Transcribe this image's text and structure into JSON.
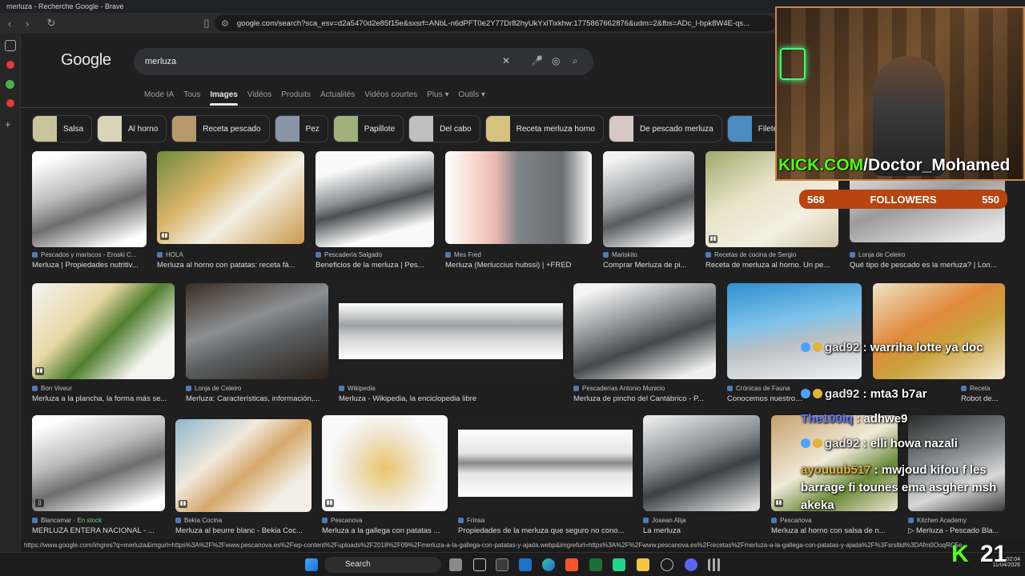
{
  "window": {
    "title": "merluza - Recherche Google - Brave"
  },
  "browser": {
    "url": "google.com/search?sca_esv=d2a5470d2e85f15e&sxsrf=ANbL-n6dPFT0e2Y77Dr82hyUkYxlTixkhw:1775867662876&udm=2&fbs=ADc_l-bpk8W4E-qs..."
  },
  "google": {
    "logo": "Google",
    "query": "merluza",
    "tabs": [
      {
        "label": "Mode IA"
      },
      {
        "label": "Tous"
      },
      {
        "label": "Images"
      },
      {
        "label": "Vidéos"
      },
      {
        "label": "Produits"
      },
      {
        "label": "Actualités"
      },
      {
        "label": "Vidéos courtes"
      },
      {
        "label": "Plus ▾"
      },
      {
        "label": "Outils ▾"
      }
    ],
    "chips": [
      {
        "label": "Salsa"
      },
      {
        "label": "Al horno"
      },
      {
        "label": "Receta pescado"
      },
      {
        "label": "Pez"
      },
      {
        "label": "Papillote"
      },
      {
        "label": "Del cabo"
      },
      {
        "label": "Receta merluza horno"
      },
      {
        "label": "De pescado merluza"
      },
      {
        "label": "Filete m"
      }
    ],
    "results": [
      {
        "source": "Pescados y mariscos - Eroski C...",
        "title": "Merluza | Propiedades nutritiv..."
      },
      {
        "source": "HOLA",
        "title": "Merluza al horno con patatas: receta fá..."
      },
      {
        "source": "Pescadería Salgado",
        "title": "Beneficios de la merluza | Pes..."
      },
      {
        "source": "Mes Fred",
        "title": "Merluza (Merluccius hubssi) | +FRED"
      },
      {
        "source": "Mariskito",
        "title": "Comprar Merluza de pi..."
      },
      {
        "source": "Recetas de cocina de Sergio",
        "title": "Receta de merluza al horno. Un pe..."
      },
      {
        "source": "Lonja de Celeiro",
        "title": "Qué tipo de pescado es la merluza? | Lon..."
      },
      {
        "source": "Bon Viveur",
        "title": "Merluza a la plancha, la forma más se..."
      },
      {
        "source": "Lonja de Celeiro",
        "title": "Merluza: Características, información,..."
      },
      {
        "source": "Wikipedia",
        "title": "Merluza - Wikipedia, la enciclopedia libre"
      },
      {
        "source": "Pescaderías Antonio Municio",
        "title": "Merluza de pincho del Cantábrico - P..."
      },
      {
        "source": "Crónicas de Fauna",
        "title": "Conocemos nuestro p..."
      },
      {
        "source": "Receta",
        "title": "Robot de..."
      },
      {
        "source": "Blancamar",
        "instock": "En stock",
        "title": "MERLUZA ENTERA NACIONAL - ..."
      },
      {
        "source": "Bekia Cocina",
        "title": "Merluza al beurre blanc - Bekia Coc..."
      },
      {
        "source": "Pescanova",
        "title": "Merluza a la gallega con patatas ..."
      },
      {
        "source": "Frinsa",
        "title": "Propiedades de la merluza que seguro no cono..."
      },
      {
        "source": "Josean Alija",
        "title": "La merluza"
      },
      {
        "source": "Pescanova",
        "title": "Merluza al horno con salsa de n..."
      },
      {
        "source": "Kitchen Academy",
        "title": "▷ Merluza - Pescado Bla..."
      }
    ]
  },
  "statusbar": {
    "url": "https://www.google.com/imgres?q=merluza&imgurl=https%3A%2F%2Fwww.pescanova.es%2Fwp-content%2Fuploads%2F2018%2F09%2Fmerluza-a-la-gallega-con-patatas-y-ajada.webp&imgrefurl=https%3A%2F%2Fwww.pescanova.es%2Frecetas%2Fmerluza-a-la-gallega-con-patatas-y-ajada%2F%3Fsrsltid%3DAfm0OoqRC5e..."
  },
  "taskbar": {
    "search": "Search",
    "time": "02:04",
    "date": "11/04/2026"
  },
  "stream": {
    "kick_prefix": "KICK.COM",
    "kick_suffix": "/Doctor_Mohamed",
    "followers_left": "568",
    "followers_label": "FOLLOWERS",
    "followers_right": "550",
    "chat": [
      {
        "user": "gad92",
        "text": " : warriha lotte ya doc"
      },
      {
        "user": "gad92",
        "text": " : mta3 b7ar"
      },
      {
        "user": "The100iq",
        "text": " : adhwe9"
      },
      {
        "user": "gad92",
        "text": " : elli howa nazali"
      },
      {
        "user": "ayouuub517",
        "text": " : mwjoud kifou f les barrage fi tounes ema asgher msh akeka"
      }
    ],
    "overlay_score": "21"
  }
}
